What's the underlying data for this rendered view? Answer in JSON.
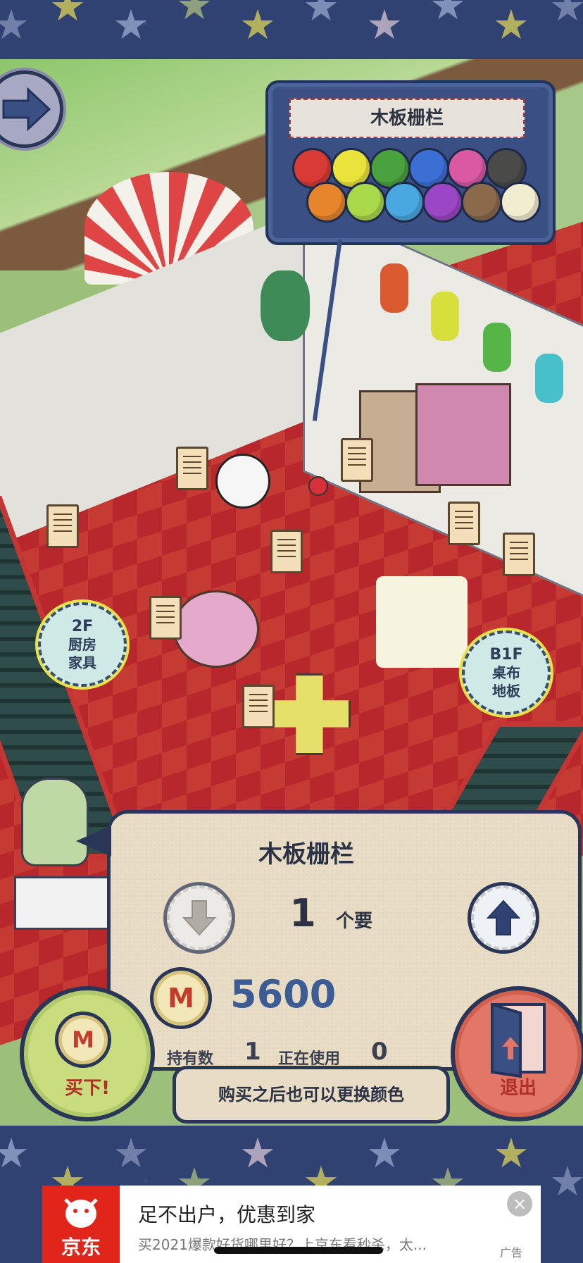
{
  "color_picker": {
    "title": "木板栅栏",
    "swatches": [
      "#d83a35",
      "#e9e33c",
      "#4aa23f",
      "#3c6fd3",
      "#d95aa3",
      "#4a4a48",
      "#e7852d",
      "#a9d84a",
      "#4aa8e0",
      "#9b46c4",
      "#8b6a4b",
      "#f2ecd0"
    ]
  },
  "floor_tags": {
    "upper": {
      "level": "2F",
      "line1": "厨房",
      "line2": "家具"
    },
    "lower": {
      "level": "B1F",
      "line1": "桌布",
      "line2": "地板"
    }
  },
  "purchase": {
    "item_name": "木板栅栏",
    "quantity": "1",
    "unit": "个要",
    "currency_symbol": "M",
    "price": "5600",
    "owned_label": "持有数",
    "owned_value": "1",
    "in_use_label": "正在使用",
    "in_use_value": "0",
    "note": "购买之后也可以更换颜色"
  },
  "buttons": {
    "buy": "买下!",
    "exit": "退出"
  },
  "ad": {
    "brand": "京东",
    "title": "足不出户，优惠到家",
    "subtitle": "买2021爆款好货哪里好？上京东看秒杀，太...",
    "tag": "广告",
    "close": "×"
  },
  "colors": {
    "panel_border": "#2a3657",
    "price_blue": "#3c5c96",
    "accent_red": "#b02f27"
  }
}
